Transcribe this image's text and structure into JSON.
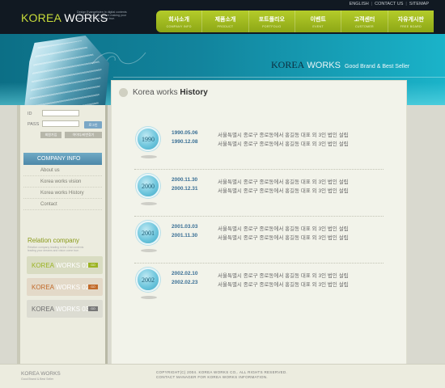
{
  "header": {
    "logo_part1": "KOREA",
    "logo_part2": "WORKS",
    "tagline": "Design Evangelisten In digital contents leader in the 21st content making your dreams and vision come true.",
    "top_links": [
      "ENGLISH",
      "CONTACT US",
      "SITEMAP"
    ],
    "separator": "|",
    "nav": [
      {
        "kr": "회사소개",
        "en": "COMPANY INFO"
      },
      {
        "kr": "제품소개",
        "en": "PRODUCT"
      },
      {
        "kr": "포트폴리오",
        "en": "PORTFOLIO"
      },
      {
        "kr": "이벤트",
        "en": "EVENT"
      },
      {
        "kr": "고객센터",
        "en": "CUSTOMER"
      },
      {
        "kr": "자유게시판",
        "en": "FREE BOARD"
      }
    ]
  },
  "banner": {
    "brand_part1": "KOREA",
    "brand_part2": "WORKS",
    "brand_slogan": "Good Brand & Best Seller"
  },
  "sidebar": {
    "login": {
      "id_label": "ID",
      "pass_label": "PASS",
      "ok_label": "로그인",
      "join_label": "회원가입",
      "find_label": "아이디/비번찾기"
    },
    "section_title": "COMPANY INFO",
    "menu": [
      "About us",
      "Korea works  vision",
      "Korea works History",
      "Contact"
    ],
    "relation_title": "Relation company",
    "relation_desc": "Relation company leading in the 21st contents leading your dreams and vision come true.",
    "relation_items": [
      {
        "kw": "KOREA",
        "rest": "WORKS 01",
        "go": "GO"
      },
      {
        "kw": "KOREA",
        "rest": "WORKS 02",
        "go": "GO"
      },
      {
        "kw": "KOREA",
        "rest": "WORKS 03",
        "go": "GO"
      }
    ]
  },
  "content": {
    "title_light": "Korea works",
    "title_bold": "History",
    "history": [
      {
        "year": "1990",
        "events": [
          {
            "date": "1990.05.06",
            "text": "서울특별시 종로구 종로동에서 홍길동 대표 외 3인 법인 설립"
          },
          {
            "date": "1990.12.08",
            "text": "서울특별시 종로구 종로동에서 홍길동 대표 외 3인 법인 설립"
          }
        ]
      },
      {
        "year": "2000",
        "events": [
          {
            "date": "2000.11.30",
            "text": "서울특별시 종로구 종로동에서 홍길동 대표 외 3인 법인 설립"
          },
          {
            "date": "2000.12.31",
            "text": "서울특별시 종로구 종로동에서 홍길동 대표 외 3인 법인 설립"
          }
        ]
      },
      {
        "year": "2001",
        "events": [
          {
            "date": "2001.03.03",
            "text": "서울특별시 종로구 종로동에서 홍길동 대표 외 3인 법인 설립"
          },
          {
            "date": "2001.11.30",
            "text": "서울특별시 종로구 종로동에서 홍길동 대표 외 3인 법인 설립"
          }
        ]
      },
      {
        "year": "2002",
        "events": [
          {
            "date": "2002.02.10",
            "text": "서울특별시 종로구 종로동에서 홍길동 대표 외 3인 법인 설립"
          },
          {
            "date": "2002.02.23",
            "text": "서울특별시 종로구 종로동에서 홍길동 대표 외 3인 법인 설립"
          }
        ]
      }
    ]
  },
  "footer": {
    "logo": "KOREA WORKS",
    "slogan": "Good Brand & Best Seller",
    "copyright": "COPYRIGHT(C) 2004. KOREA WORKS CO,. ALL RIGHTS RESERVED.",
    "contact": "CONTACT MANAGER FOR KOREA WORKS INFORMATION."
  },
  "colors": {
    "accent_green": "#a6c01f",
    "accent_teal": "#12849d",
    "date_blue": "#3a6f95"
  }
}
